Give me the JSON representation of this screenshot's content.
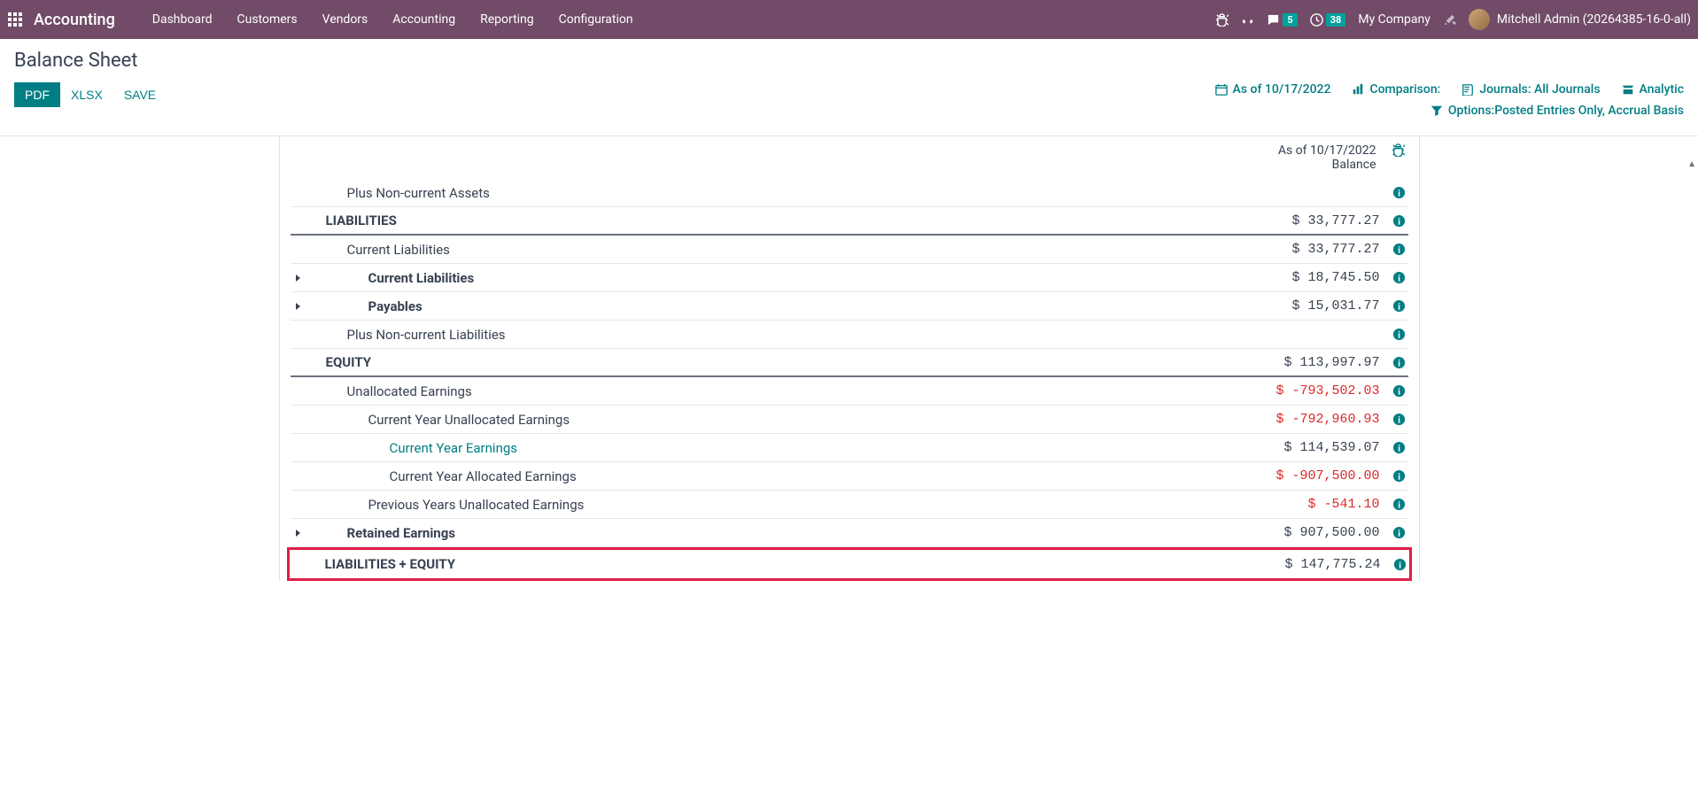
{
  "topbar": {
    "app_name": "Accounting",
    "nav": [
      "Dashboard",
      "Customers",
      "Vendors",
      "Accounting",
      "Reporting",
      "Configuration"
    ],
    "messages_badge": "5",
    "activities_badge": "38",
    "company": "My Company",
    "user": "Mitchell Admin (20264385-16-0-all)"
  },
  "header": {
    "title": "Balance Sheet"
  },
  "toolbar": {
    "pdf": "PDF",
    "xlsx": "XLSX",
    "save": "SAVE"
  },
  "filters": {
    "date": "As of 10/17/2022",
    "comparison": "Comparison:",
    "journals": "Journals: All Journals",
    "analytic": "Analytic",
    "options": "Options:Posted Entries Only, Accrual Basis"
  },
  "report": {
    "date_header": "As of 10/17/2022",
    "balance_header": "Balance"
  },
  "rows": [
    {
      "label": "Plus Non-current Assets",
      "value": "",
      "indent": 2,
      "bold": false,
      "caret": false,
      "section": false,
      "negative": false,
      "link": false
    },
    {
      "label": "LIABILITIES",
      "value": "$ 33,777.27",
      "indent": 1,
      "bold": true,
      "caret": false,
      "section": true,
      "negative": false,
      "link": false
    },
    {
      "label": "Current Liabilities",
      "value": "$ 33,777.27",
      "indent": 2,
      "bold": false,
      "caret": false,
      "section": false,
      "negative": false,
      "link": false
    },
    {
      "label": "Current Liabilities",
      "value": "$ 18,745.50",
      "indent": 3,
      "bold": true,
      "caret": true,
      "section": false,
      "negative": false,
      "link": false
    },
    {
      "label": "Payables",
      "value": "$ 15,031.77",
      "indent": 3,
      "bold": true,
      "caret": true,
      "section": false,
      "negative": false,
      "link": false
    },
    {
      "label": "Plus Non-current Liabilities",
      "value": "",
      "indent": 2,
      "bold": false,
      "caret": false,
      "section": false,
      "negative": false,
      "link": false
    },
    {
      "label": "EQUITY",
      "value": "$ 113,997.97",
      "indent": 1,
      "bold": true,
      "caret": false,
      "section": true,
      "negative": false,
      "link": false
    },
    {
      "label": "Unallocated Earnings",
      "value": "$ -793,502.03",
      "indent": 2,
      "bold": false,
      "caret": false,
      "section": false,
      "negative": true,
      "link": false
    },
    {
      "label": "Current Year Unallocated Earnings",
      "value": "$ -792,960.93",
      "indent": 3,
      "bold": false,
      "caret": false,
      "section": false,
      "negative": true,
      "link": false
    },
    {
      "label": "Current Year Earnings",
      "value": "$ 114,539.07",
      "indent": 4,
      "bold": false,
      "caret": false,
      "section": false,
      "negative": false,
      "link": true
    },
    {
      "label": "Current Year Allocated Earnings",
      "value": "$ -907,500.00",
      "indent": 4,
      "bold": false,
      "caret": false,
      "section": false,
      "negative": true,
      "link": false
    },
    {
      "label": "Previous Years Unallocated Earnings",
      "value": "$ -541.10",
      "indent": 3,
      "bold": false,
      "caret": false,
      "section": false,
      "negative": true,
      "link": false
    },
    {
      "label": "Retained Earnings",
      "value": "$ 907,500.00",
      "indent": 2,
      "bold": true,
      "caret": true,
      "section": false,
      "negative": false,
      "link": false
    },
    {
      "label": "LIABILITIES + EQUITY",
      "value": "$ 147,775.24",
      "indent": 1,
      "bold": true,
      "caret": false,
      "section": false,
      "negative": false,
      "link": false,
      "highlight": true
    }
  ]
}
